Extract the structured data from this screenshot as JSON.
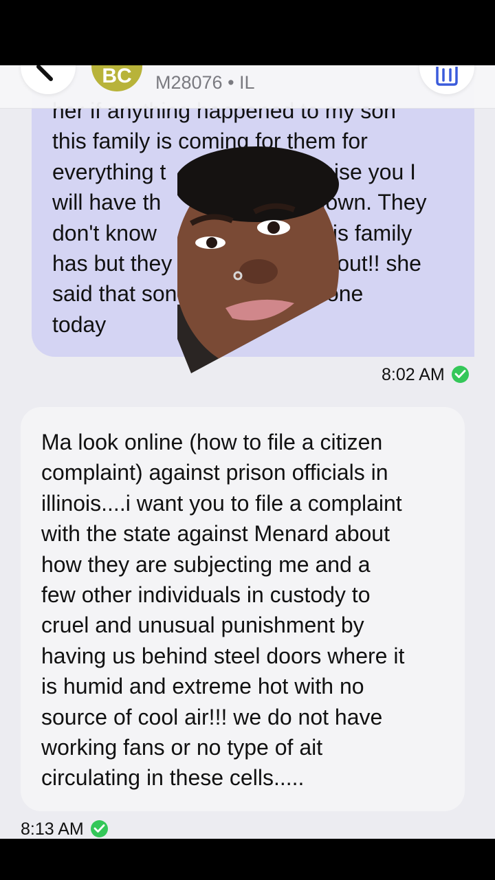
{
  "header": {
    "avatar_initials": "BC",
    "contact_subtitle": "M28076 • IL"
  },
  "messages": [
    {
      "direction": "outgoing",
      "text": "her if anything happened to my son\nthis family is coming for them for\neverything t                        I promise you I\nwill have th                             ut down. They\ndon't know                                 f this family\nhas but they                            find out!! she\nsaid that son                           e done\ntoday",
      "time": "8:02 AM"
    },
    {
      "direction": "incoming",
      "text": "Ma look online (how to file a citizen\ncomplaint) against prison officials in\nillinois....i want you to file a complaint\nwith the state against Menard about\nhow they are subjecting me and a\nfew other individuals in custody to\ncruel and unusual punishment by\nhaving us behind steel doors where it\nis humid and extreme hot with no\nsource of cool air!!! we do not have\nworking fans or no type of ait\ncirculating in these cells.....",
      "time": "8:13 AM"
    }
  ],
  "colors": {
    "outgoing_bubble": "#d4d4f3",
    "incoming_bubble": "#f4f4f6",
    "delivered_check": "#34c759",
    "avatar": "#b8b33a"
  },
  "icons": {
    "back": "chevron-left-icon",
    "delete": "trash-icon",
    "delivered": "check-circle-icon"
  }
}
